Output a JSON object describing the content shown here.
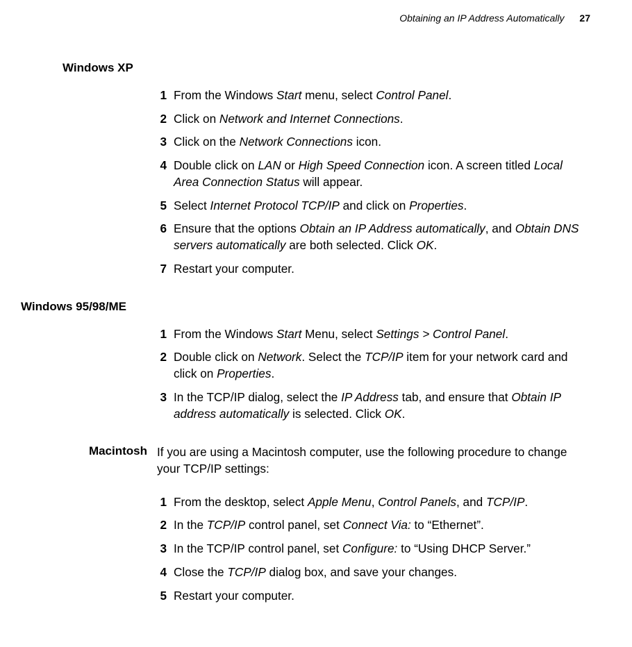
{
  "header": {
    "title": "Obtaining an IP Address Automatically",
    "page": "27"
  },
  "sections": {
    "winxp": {
      "label": "Windows XP",
      "items": [
        {
          "n": "1",
          "html": "From the Windows <span class='italic'>Start</span> menu, select <span class='italic'>Control Panel</span>."
        },
        {
          "n": "2",
          "html": "Click on <span class='italic'>Network and Internet Connections</span>."
        },
        {
          "n": "3",
          "html": "Click on the <span class='italic'>Network Connections</span> icon."
        },
        {
          "n": "4",
          "html": "Double click on <span class='italic'>LAN</span> or <span class='italic'>High Speed Connection</span> icon. A screen titled <span class='italic'>Local Area Connection Status</span> will appear."
        },
        {
          "n": "5",
          "html": "Select <span class='italic'>Internet Protocol TCP/IP</span> and click on <span class='italic'>Properties</span>."
        },
        {
          "n": "6",
          "html": "Ensure that the options <span class='italic'>Obtain an IP Address automatically</span>, and <span class='italic'>Obtain DNS servers automatically</span> are both selected. Click <span class='italic'>OK</span>."
        },
        {
          "n": "7",
          "html": "Restart your computer."
        }
      ]
    },
    "win9x": {
      "label": "Windows 95/98/ME",
      "items": [
        {
          "n": "1",
          "html": "From the Windows <span class='italic'>Start</span> Menu, select <span class='italic'>Settings > Control Panel</span>."
        },
        {
          "n": "2",
          "html": "Double click on <span class='italic'>Network</span>. Select the <span class='italic'>TCP/IP</span> item for your network card and click on <span class='italic'>Properties</span>."
        },
        {
          "n": "3",
          "html": "In the TCP/IP dialog, select the <span class='italic'>IP Address</span> tab, and ensure that <span class='italic'>Obtain IP address automatically</span> is selected. Click <span class='italic'>OK</span>."
        }
      ]
    },
    "mac": {
      "label": "Macintosh",
      "intro": "If you are using a Macintosh computer, use the following procedure to change your TCP/IP settings:",
      "items": [
        {
          "n": "1",
          "html": "From the desktop, select <span class='italic'>Apple Menu</span>, <span class='italic'>Control Panels</span>, and <span class='italic'>TCP/IP</span>."
        },
        {
          "n": "2",
          "html": "In the <span class='italic'>TCP/IP</span> control panel, set <span class='italic'>Connect Via:</span> to “Ethernet”."
        },
        {
          "n": "3",
          "html": "In the TCP/IP control panel, set <span class='italic'>Configure:</span> to “Using DHCP Server.”"
        },
        {
          "n": "4",
          "html": "Close the <span class='italic'>TCP/IP</span> dialog box, and save your changes."
        },
        {
          "n": "5",
          "html": "Restart your computer."
        }
      ]
    }
  }
}
